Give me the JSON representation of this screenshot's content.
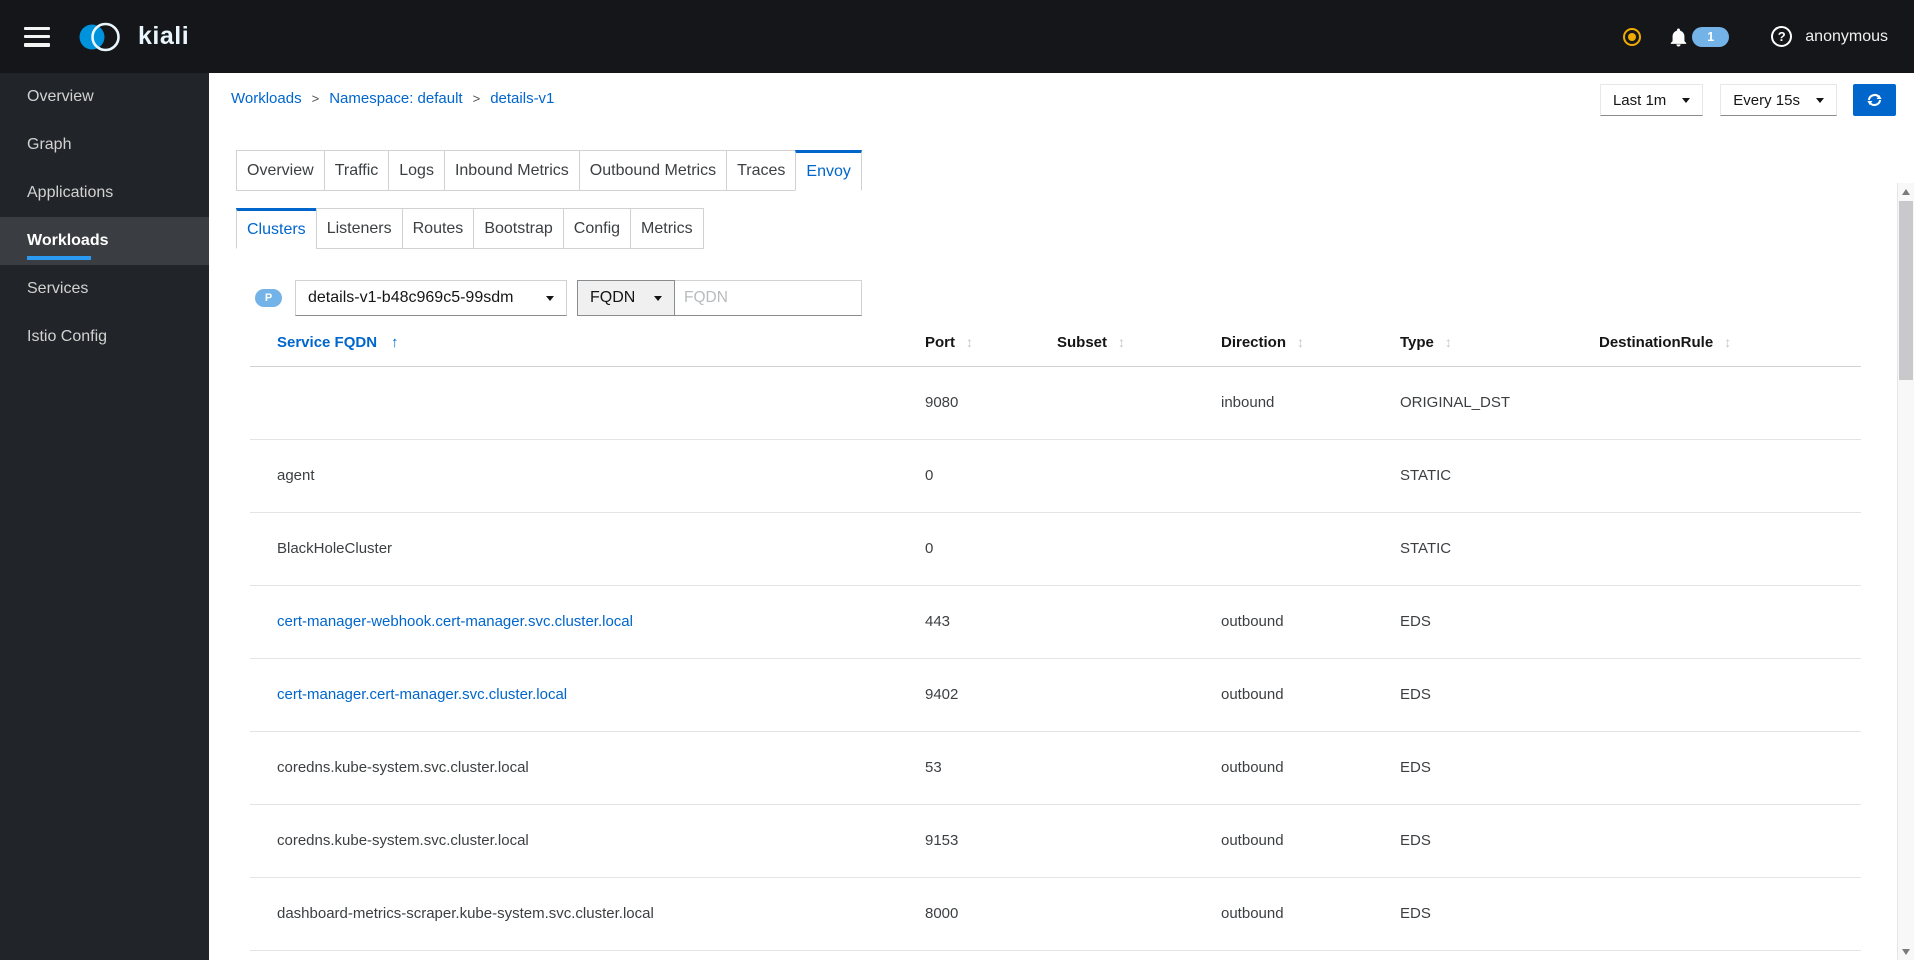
{
  "masthead": {
    "brand": "kiali",
    "notification_count": "1",
    "user": "anonymous"
  },
  "sidebar": {
    "items": [
      {
        "label": "Overview",
        "active": false
      },
      {
        "label": "Graph",
        "active": false
      },
      {
        "label": "Applications",
        "active": false
      },
      {
        "label": "Workloads",
        "active": true
      },
      {
        "label": "Services",
        "active": false
      },
      {
        "label": "Istio Config",
        "active": false
      }
    ]
  },
  "breadcrumb": {
    "items": [
      "Workloads",
      "Namespace: default",
      "details-v1"
    ]
  },
  "toolbar": {
    "duration": "Last 1m",
    "refresh_interval": "Every 15s"
  },
  "tabs": {
    "main": {
      "labels": [
        "Overview",
        "Traffic",
        "Logs",
        "Inbound Metrics",
        "Outbound Metrics",
        "Traces",
        "Envoy"
      ],
      "active_index": 6
    },
    "sub": {
      "labels": [
        "Clusters",
        "Listeners",
        "Routes",
        "Bootstrap",
        "Config",
        "Metrics"
      ],
      "active_index": 0
    }
  },
  "filters": {
    "pod_badge": "P",
    "pod_value": "details-v1-b48c969c5-99sdm",
    "match_value": "FQDN",
    "search_placeholder": "FQDN"
  },
  "table": {
    "columns": [
      "Service FQDN",
      "Port",
      "Subset",
      "Direction",
      "Type",
      "DestinationRule"
    ],
    "sorted_column": "Service FQDN",
    "sort_direction": "asc",
    "rows": [
      {
        "cells": [
          "",
          "9080",
          "",
          "inbound",
          "ORIGINAL_DST",
          ""
        ],
        "link": false
      },
      {
        "cells": [
          "agent",
          "0",
          "",
          "",
          "STATIC",
          ""
        ],
        "link": false
      },
      {
        "cells": [
          "BlackHoleCluster",
          "0",
          "",
          "",
          "STATIC",
          ""
        ],
        "link": false
      },
      {
        "cells": [
          "cert-manager-webhook.cert-manager.svc.cluster.local",
          "443",
          "",
          "outbound",
          "EDS",
          ""
        ],
        "link": true
      },
      {
        "cells": [
          "cert-manager.cert-manager.svc.cluster.local",
          "9402",
          "",
          "outbound",
          "EDS",
          ""
        ],
        "link": true
      },
      {
        "cells": [
          "coredns.kube-system.svc.cluster.local",
          "53",
          "",
          "outbound",
          "EDS",
          ""
        ],
        "link": false
      },
      {
        "cells": [
          "coredns.kube-system.svc.cluster.local",
          "9153",
          "",
          "outbound",
          "EDS",
          ""
        ],
        "link": false
      },
      {
        "cells": [
          "dashboard-metrics-scraper.kube-system.svc.cluster.local",
          "8000",
          "",
          "outbound",
          "EDS",
          ""
        ],
        "link": false
      }
    ]
  },
  "colors": {
    "accent": "#0066cc",
    "masthead_bg": "#141619",
    "sidebar_bg": "#212428",
    "nav_active_underline": "#2b9af3",
    "badge_blue": "#73b3e7",
    "status_warning": "#f0ab00",
    "brand_circle_blue": "#0093dd"
  }
}
